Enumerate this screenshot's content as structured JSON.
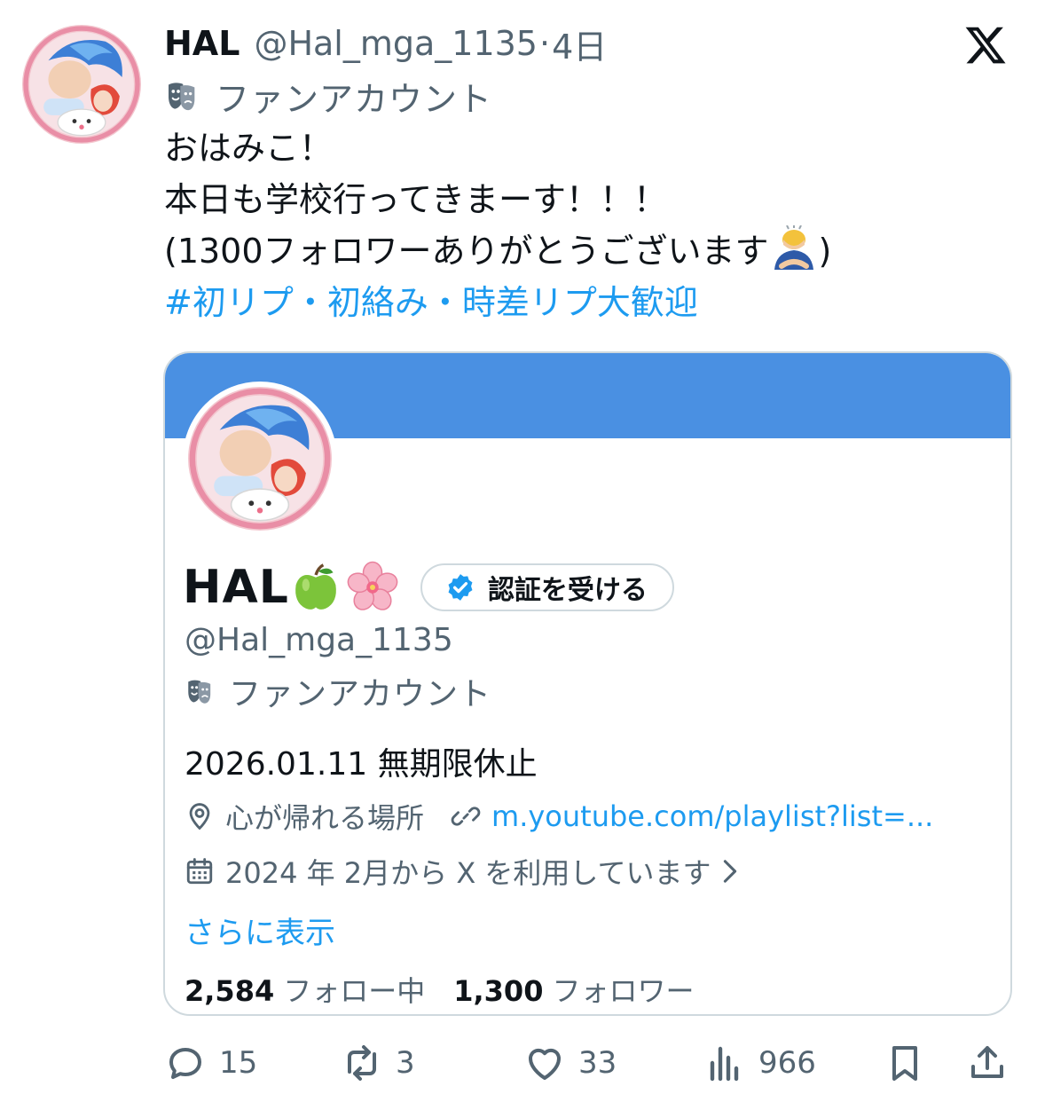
{
  "post": {
    "author_name": "HAL",
    "author_handle": "@Hal_mga_1135",
    "separator": "·",
    "age": "4日",
    "account_label": "ファンアカウント",
    "body_lines": [
      "おはみこ！",
      "本日も学校行ってきまーす！！！"
    ],
    "body_line3_pre": "(1300フォロワーありがとうございます",
    "body_line3_post": ")",
    "hashtag_line": "#初リプ・初絡み・時差リプ大歓迎"
  },
  "card": {
    "name": "HAL",
    "verify_button": "認証を受ける",
    "handle": "@Hal_mga_1135",
    "account_label": "ファンアカウント",
    "bio": "2026.01.11 無期限休止",
    "location": "心が帰れる場所",
    "link": "m.youtube.com/playlist?list=...",
    "joined": "2024 年 2月から X を利用しています",
    "show_more": "さらに表示",
    "following_count": "2,584",
    "following_label": "フォロー中",
    "followers_count": "1,300",
    "followers_label": "フォロワー",
    "banner_color": "#4a90e2"
  },
  "actions": {
    "replies": "15",
    "reposts": "3",
    "likes": "33",
    "views": "966"
  },
  "icons": {
    "header": [
      "x-logo-icon",
      "theater-mask-icon"
    ],
    "actions": [
      "reply-icon",
      "repost-icon",
      "like-icon",
      "views-icon",
      "bookmark-icon",
      "share-icon"
    ],
    "card": [
      "verified-badge-icon",
      "location-pin-icon",
      "link-icon",
      "calendar-icon",
      "chevron-right-icon"
    ],
    "emoji": [
      "green-apple-emoji",
      "cherry-blossom-emoji",
      "bowing-person-emoji"
    ]
  },
  "colors": {
    "text": "#0f1419",
    "secondary": "#536471",
    "accent": "#1d9bf0",
    "border": "#cfd9de"
  }
}
